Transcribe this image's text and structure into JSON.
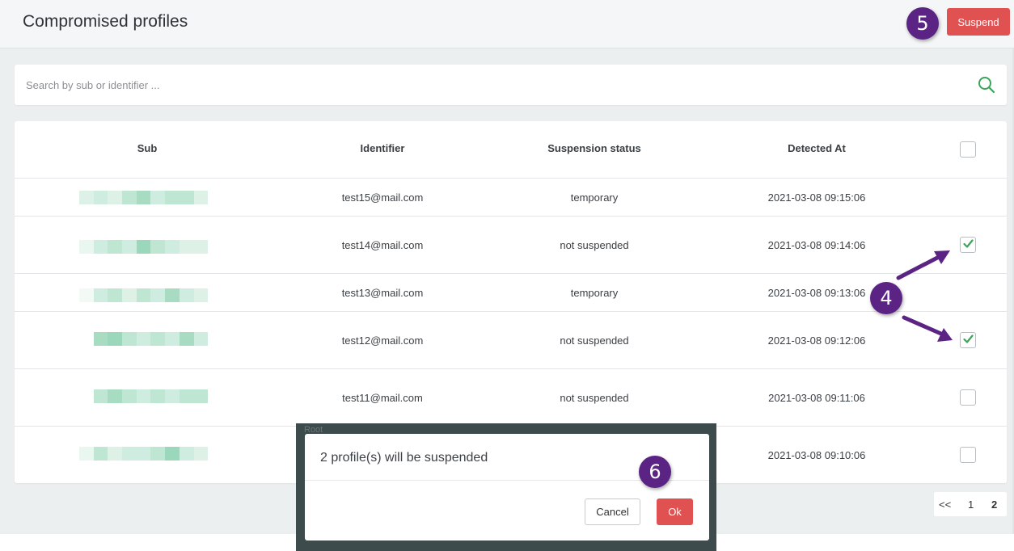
{
  "header": {
    "title": "Compromised profiles",
    "suspend_label": "Suspend"
  },
  "markers": {
    "m4": "4",
    "m5": "5",
    "m6": "6"
  },
  "search": {
    "placeholder": "Search by sub or identifier ..."
  },
  "table": {
    "columns": [
      "Sub",
      "Identifier",
      "Suspension status",
      "Detected At"
    ],
    "rows": [
      {
        "identifier": "test15@mail.com",
        "status": "temporary",
        "detected_at": "2021-03-08 09:15:06",
        "checkbox": "none"
      },
      {
        "identifier": "test14@mail.com",
        "status": "not suspended",
        "detected_at": "2021-03-08 09:14:06",
        "checkbox": "checked"
      },
      {
        "identifier": "test13@mail.com",
        "status": "temporary",
        "detected_at": "2021-03-08 09:13:06",
        "checkbox": "none"
      },
      {
        "identifier": "test12@mail.com",
        "status": "not suspended",
        "detected_at": "2021-03-08 09:12:06",
        "checkbox": "checked"
      },
      {
        "identifier": "test11@mail.com",
        "status": "not suspended",
        "detected_at": "2021-03-08 09:11:06",
        "checkbox": "unchecked"
      },
      {
        "identifier": "",
        "status": "",
        "detected_at": "2021-03-08 09:10:06",
        "checkbox": "unchecked"
      }
    ]
  },
  "pagination": {
    "first": "<<",
    "page1": "1",
    "page2": "2"
  },
  "modal": {
    "ghost_text": "Root",
    "message": "2 profile(s) will be suspended",
    "cancel_label": "Cancel",
    "ok_label": "Ok"
  },
  "colors": {
    "accent_red": "#e05252",
    "marker_purple": "#5b2484",
    "check_green": "#3aa55a"
  }
}
